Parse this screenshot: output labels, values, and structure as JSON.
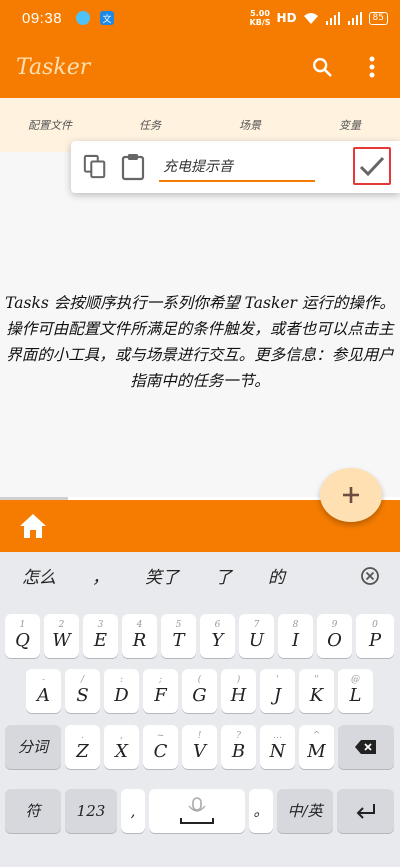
{
  "status_bar": {
    "time": "09:38",
    "app_icon_glyph": "文",
    "net_speed_value": "5.00",
    "net_speed_unit": "KB/S",
    "hd_label": "HD",
    "battery": "85"
  },
  "app_bar": {
    "title": "Tasker"
  },
  "tabs": [
    "配置文件",
    "任务",
    "场景",
    "变量"
  ],
  "edit_popup": {
    "input_value": "充电提示音"
  },
  "main": {
    "description": "Tasks 会按顺序执行一系列你希望 Tasker 运行的操作。操作可由配置文件所满足的条件触发，或者也可以点击主界面的小工具，或与场景进行交互。更多信息：参见用户指南中的任务一节。"
  },
  "ime": {
    "candidates": [
      "怎么",
      "，",
      "笑了",
      "了",
      "的"
    ],
    "rows": [
      [
        {
          "main": "Q",
          "sub": "1"
        },
        {
          "main": "W",
          "sub": "2"
        },
        {
          "main": "E",
          "sub": "3"
        },
        {
          "main": "R",
          "sub": "4"
        },
        {
          "main": "T",
          "sub": "5"
        },
        {
          "main": "Y",
          "sub": "6"
        },
        {
          "main": "U",
          "sub": "7"
        },
        {
          "main": "I",
          "sub": "8"
        },
        {
          "main": "O",
          "sub": "9"
        },
        {
          "main": "P",
          "sub": "0"
        }
      ],
      [
        {
          "main": "A",
          "sub": "-"
        },
        {
          "main": "S",
          "sub": "/"
        },
        {
          "main": "D",
          "sub": ":"
        },
        {
          "main": "F",
          "sub": ";"
        },
        {
          "main": "G",
          "sub": "("
        },
        {
          "main": "H",
          "sub": ")"
        },
        {
          "main": "J",
          "sub": "'"
        },
        {
          "main": "K",
          "sub": "\""
        },
        {
          "main": "L",
          "sub": "@"
        }
      ],
      [
        {
          "main": "Z",
          "sub": "."
        },
        {
          "main": "X",
          "sub": ","
        },
        {
          "main": "C",
          "sub": "~"
        },
        {
          "main": "V",
          "sub": "!"
        },
        {
          "main": "B",
          "sub": "?"
        },
        {
          "main": "N",
          "sub": "…"
        },
        {
          "main": "M",
          "sub": "^"
        }
      ]
    ],
    "fenci": "分词",
    "symbol": "符",
    "num_123": "123",
    "comma": ",",
    "lang_switch": "中/英",
    "period": "。"
  },
  "colors": {
    "primary": "#f57c00",
    "accent_light": "#ffe0b2",
    "highlight_border": "#e53935"
  },
  "icons": [
    "search-icon",
    "more-vert-icon",
    "copy-icon",
    "clipboard-icon",
    "check-icon",
    "add-icon",
    "home-icon",
    "close-circle-icon",
    "backspace-icon",
    "microphone-icon",
    "enter-icon"
  ]
}
